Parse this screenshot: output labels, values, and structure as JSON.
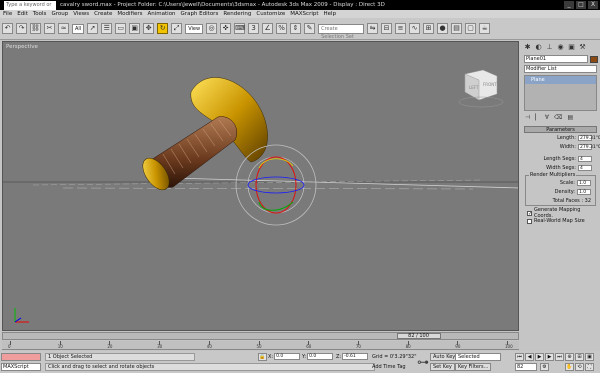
{
  "window": {
    "search_placeholder": "Type a keyword or phrase",
    "title": "cavalry sword.max    -  Project Folder: C:\\Users\\Jewell\\Documents\\3dsmax    -  Autodesk 3ds Max  2009         -  Display : Direct 3D",
    "controls": [
      "_",
      "□",
      "X"
    ]
  },
  "menu": [
    "File",
    "Edit",
    "Tools",
    "Group",
    "Views",
    "Create",
    "Modifiers",
    "Animation",
    "Graph Editors",
    "Rendering",
    "Customize",
    "MAXScript",
    "Help"
  ],
  "toolbar": {
    "selection_filter": "All",
    "ref_coord": "View",
    "named_selection": "Create Selection Set"
  },
  "viewport": {
    "label": "Perspective",
    "viewcube_left": "LEFT",
    "viewcube_front": "FRONT"
  },
  "command_panel": {
    "object_name": "Plane01",
    "modifier_list": "Modifier List",
    "stack_item": "Plane",
    "rollout_title": "Parameters",
    "length_label": "Length:",
    "length_value": "279.31\"0'",
    "width_label": "Width:",
    "width_value": "279.31\"0'",
    "length_segs_label": "Length Segs:",
    "length_segs_value": "4",
    "width_segs_label": "Width Segs:",
    "width_segs_value": "4",
    "render_group": "Render Multipliers",
    "scale_label": "Scale:",
    "scale_value": "1.0",
    "density_label": "Density:",
    "density_value": "1.0",
    "total_faces": "Total Faces : 32",
    "gen_mapping": "Generate Mapping Coords.",
    "real_world": "Real-World Map Size",
    "gen_mapping_checked": "✓"
  },
  "timeline": {
    "slider": "82 / 100",
    "ticks": [
      "0",
      "10",
      "20",
      "30",
      "40",
      "50",
      "60",
      "70",
      "80",
      "90",
      "100"
    ],
    "current_fraction": 0.82
  },
  "status": {
    "script_label": "MAXScript",
    "selected": "1 Object Selected",
    "prompt": "Click and drag to select and rotate objects",
    "x_label": "X:",
    "x_value": "0.0",
    "y_label": "Y:",
    "y_value": "0.0",
    "z_label": "Z:",
    "z_value": "-0.61",
    "grid": "Grid = 0'3.29\"32\"",
    "add_time_tag": "Add Time Tag",
    "auto_key": "Auto Key",
    "set_key": "Set Key",
    "selected_dropdown": "Selected",
    "key_filters": "Key Filters...",
    "frame": "82"
  },
  "colors": {
    "viewport_bg": "#7a7a7a",
    "active_tool": "#f2c400",
    "object_color": "#8b4a12",
    "mx_listener": "#ef9d9d"
  }
}
